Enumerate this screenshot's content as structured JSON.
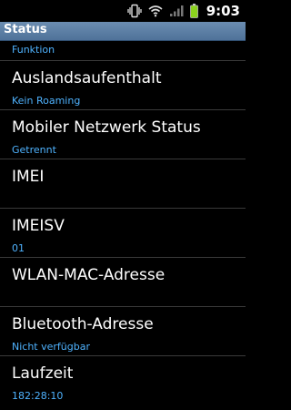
{
  "status_bar": {
    "time": "9:03",
    "icons": [
      "vibrate-icon",
      "wifi-icon",
      "signal-icon",
      "battery-icon"
    ],
    "battery_color": "#8bd21d"
  },
  "title_bar": {
    "title": "Status"
  },
  "list": {
    "items": [
      {
        "title": "",
        "summary": "Funktion"
      },
      {
        "title": "Auslandsaufenthalt",
        "summary": "Kein Roaming"
      },
      {
        "title": "Mobiler Netzwerk Status",
        "summary": "Getrennt"
      },
      {
        "title": "IMEI",
        "summary": ""
      },
      {
        "title": "IMEISV",
        "summary": "01"
      },
      {
        "title": "WLAN-MAC-Adresse",
        "summary": ""
      },
      {
        "title": "Bluetooth-Adresse",
        "summary": "Nicht verfügbar"
      },
      {
        "title": "Laufzeit",
        "summary": "182:28:10"
      }
    ]
  }
}
